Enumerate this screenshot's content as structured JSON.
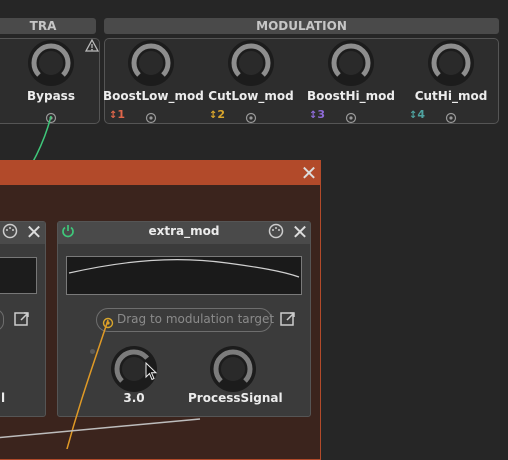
{
  "header": {
    "extra_label": "TRA",
    "modulation_label": "MODULATION"
  },
  "bypass": {
    "label": "Bypass"
  },
  "macros": [
    {
      "label": "BoostLow_mod",
      "index": "1",
      "color": "#e0664a"
    },
    {
      "label": "CutLow_mod",
      "index": "2",
      "color": "#d9a62c"
    },
    {
      "label": "BoostHi_mod",
      "index": "3",
      "color": "#8e6bd8"
    },
    {
      "label": "CutHi_mod",
      "index": "4",
      "color": "#4fa3a0"
    }
  ],
  "device": {
    "title": "extra_mod",
    "drag_label": "Drag to modulation target",
    "knob_value": "3.0",
    "process_label": "ProcessSignal"
  },
  "left_device": {
    "partial_label": "l"
  },
  "colors": {
    "container": "#b24a2a",
    "cable_green": "#3fc77a",
    "cable_orange": "#e09a26"
  }
}
